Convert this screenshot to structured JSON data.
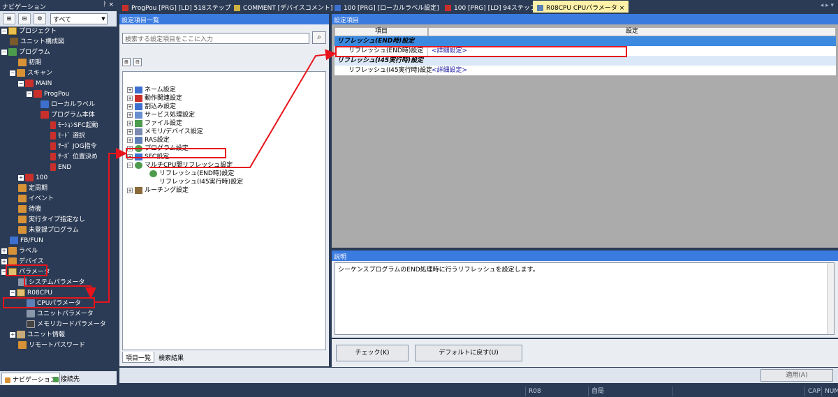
{
  "navigation": {
    "title": "ナビゲーション",
    "pin_controls": "ᚹ ×",
    "filter_value": "すべて",
    "tree": [
      {
        "label": "プロジェクト"
      },
      {
        "label": "ユニット構成図"
      },
      {
        "label": "プログラム"
      },
      {
        "label": "初期"
      },
      {
        "label": "スキャン"
      },
      {
        "label": "MAIN"
      },
      {
        "label": "ProgPou"
      },
      {
        "label": "ローカルラベル"
      },
      {
        "label": "プログラム本体"
      },
      {
        "label": "ﾓｰｼｮﾝSFC起動"
      },
      {
        "label": "ﾓｰﾄﾞ 選択"
      },
      {
        "label": "ｻｰﾎﾞ JOG指令"
      },
      {
        "label": "ｻｰﾎﾞ 位置決め"
      },
      {
        "label": "END"
      },
      {
        "label": "100"
      },
      {
        "label": "定周期"
      },
      {
        "label": "イベント"
      },
      {
        "label": "待機"
      },
      {
        "label": "実行タイプ指定なし"
      },
      {
        "label": "未登録プログラム"
      },
      {
        "label": "FB/FUN"
      },
      {
        "label": "ラベル"
      },
      {
        "label": "デバイス"
      },
      {
        "label": "パラメータ"
      },
      {
        "label": "システムパラメータ"
      },
      {
        "label": "R08CPU"
      },
      {
        "label": "CPUパラメータ"
      },
      {
        "label": "ユニットパラメータ"
      },
      {
        "label": "メモリカードパラメータ"
      },
      {
        "label": "ユニット情報"
      },
      {
        "label": "リモートパスワード"
      }
    ],
    "bottom_tabs": [
      "ナビゲーション",
      "接続先"
    ]
  },
  "tabs": [
    {
      "label": "ProgPou [PRG] [LD] 518ステップ"
    },
    {
      "label": "COMMENT [デバイスコメント]"
    },
    {
      "label": "100 [PRG] [ローカルラベル設定]"
    },
    {
      "label": "100 [PRG] [LD] 94ステップ"
    },
    {
      "label": "R08CPU CPUパラメータ ×"
    }
  ],
  "tab_scroll": "◂ ▸ ▾",
  "settings_list": {
    "title": "設定項目一覧",
    "search_placeholder": "検索する設定項目をここに入力",
    "items": [
      {
        "label": "ネーム設定"
      },
      {
        "label": "動作関連設定"
      },
      {
        "label": "割込み設定"
      },
      {
        "label": "サービス処理設定"
      },
      {
        "label": "ファイル設定"
      },
      {
        "label": "メモリ/デバイス設定"
      },
      {
        "label": "RAS設定"
      },
      {
        "label": "プログラム設定"
      },
      {
        "label": "SFC設定"
      },
      {
        "label": "マルチCPU間リフレッシュ設定"
      },
      {
        "label": "リフレッシュ(END時)設定"
      },
      {
        "label": "リフレッシュ(I45実行時)設定"
      },
      {
        "label": "ルーチング設定"
      }
    ],
    "tabs": [
      "項目一覧",
      "検索結果"
    ]
  },
  "settings_grid": {
    "title": "設定項目",
    "col_item": "項目",
    "col_setting": "設定",
    "rows": [
      {
        "group": "リフレッシュ(END時)設定",
        "name": "リフレッシュ(END時)設定",
        "value": "<詳細設定>"
      },
      {
        "group": "リフレッシュ(I45実行時)設定",
        "name": "リフレッシュ(I45実行時)設定",
        "value": "<詳細設定>"
      }
    ]
  },
  "description": {
    "title": "説明",
    "text": "シーケンスプログラムのEND処理時に行うリフレッシュを設定します。"
  },
  "buttons": {
    "check": "チェック(K)",
    "default": "デフォルトに戻す(U)",
    "apply": "適用(A)"
  },
  "status_bar": {
    "cpu": "R08",
    "station": "自局",
    "cap": "CAP",
    "num": "NUM"
  },
  "colors": {
    "nav_bg": "#2b3b55",
    "pane_header": "#3a7be0",
    "active_tab": "#fff2a8",
    "annotation_red": "#e8141c",
    "grid_bg": "#ababab"
  }
}
